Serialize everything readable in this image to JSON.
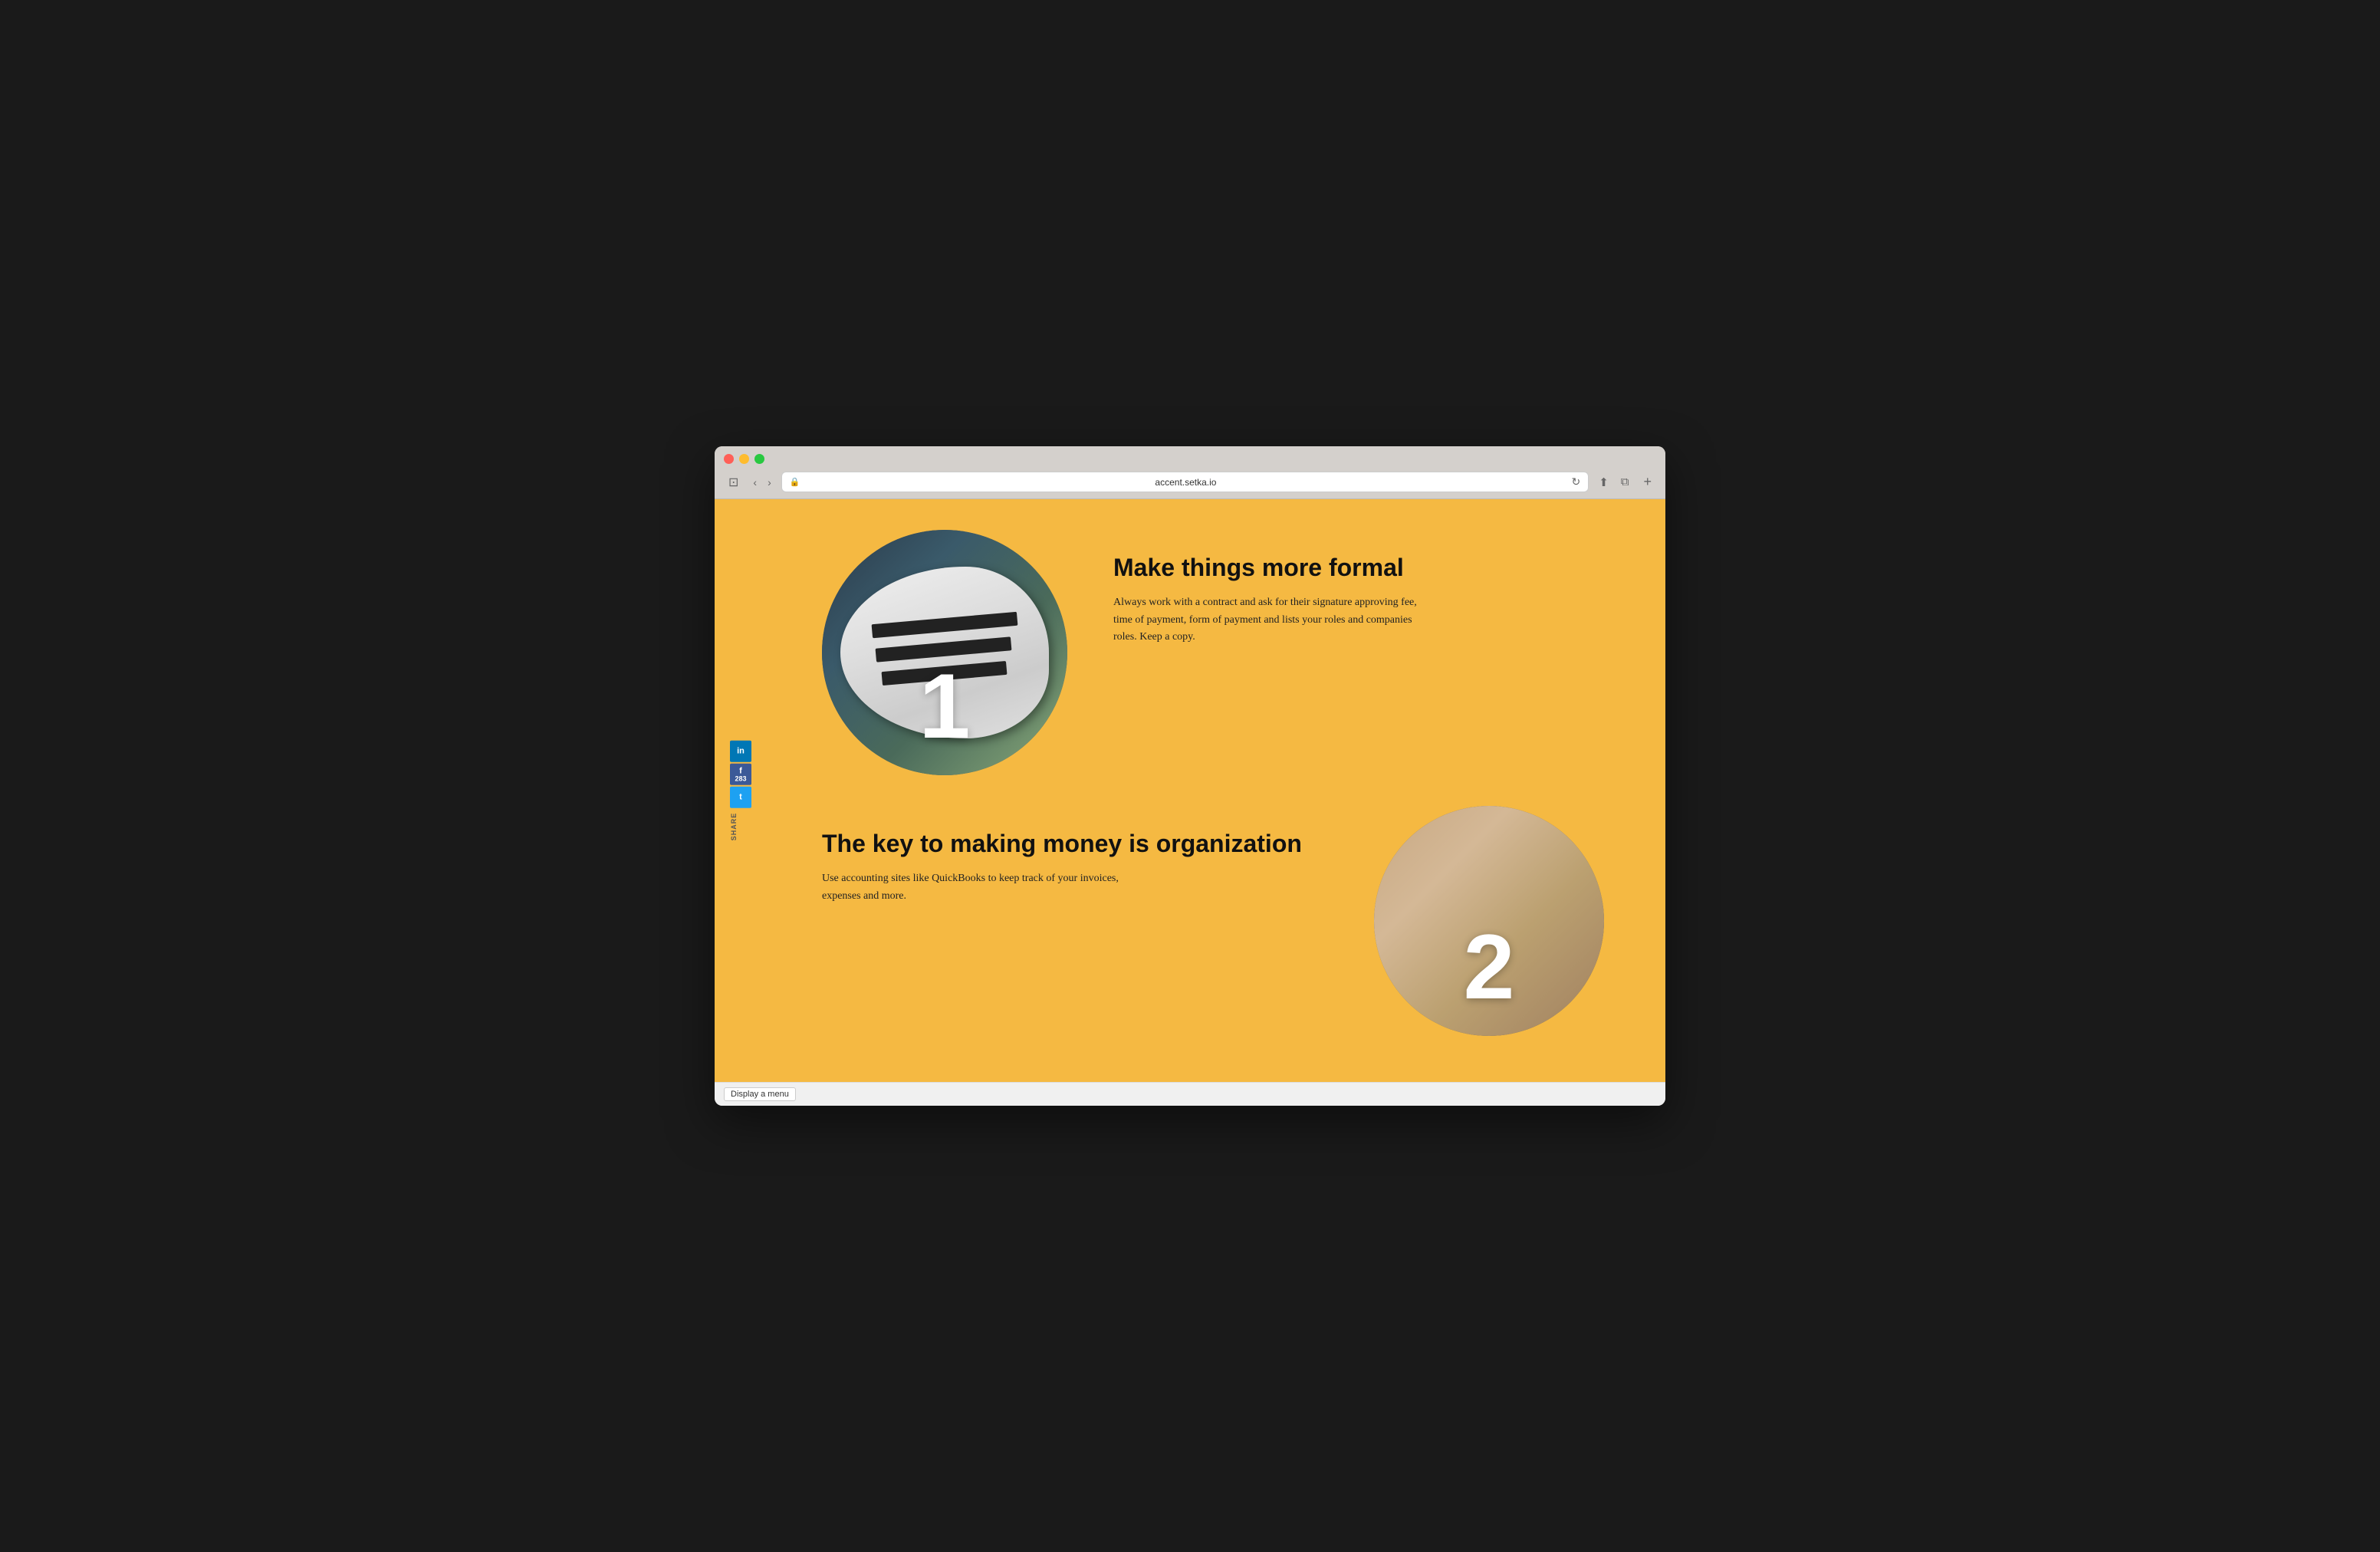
{
  "browser": {
    "url": "accent.setka.io",
    "traffic_lights": [
      "red",
      "yellow",
      "green"
    ]
  },
  "share": {
    "linkedin_label": "in",
    "facebook_label": "f",
    "facebook_count": "283",
    "twitter_label": "t",
    "share_text": "SHARE"
  },
  "section1": {
    "number": "1",
    "title": "Make things more formal",
    "body": "Always work with a contract and ask for their signature approving fee, time of payment, form of payment and lists your roles and companies roles. Keep a copy."
  },
  "section2": {
    "number": "2",
    "title": "The key to making money is organization",
    "body": "Use accounting sites like QuickBooks to keep track of your invoices, expenses and more."
  },
  "bottom_bar": {
    "display_menu_label": "Display a menu"
  },
  "toolbar": {
    "nav_back": "‹",
    "nav_forward": "›",
    "sidebar_icon": "⊡",
    "reload_icon": "↻",
    "share_icon": "⬆",
    "fullscreen_icon": "⧉",
    "new_tab": "+"
  }
}
